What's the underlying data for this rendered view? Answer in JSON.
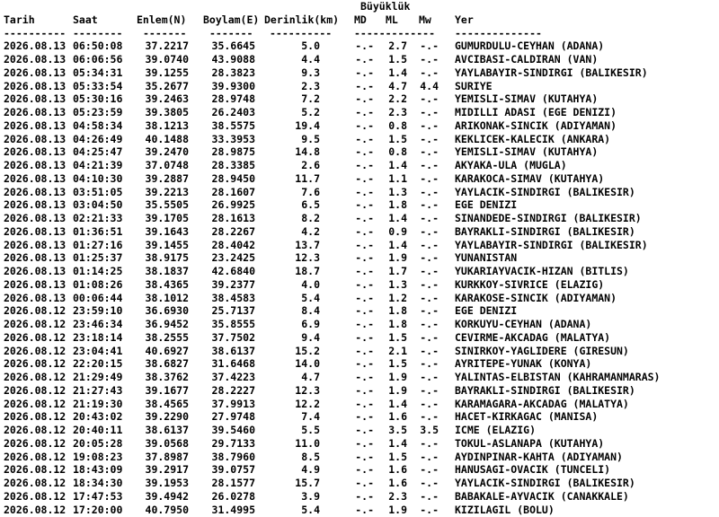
{
  "header": {
    "group_title": "Büyüklük",
    "columns": {
      "date": "Tarih",
      "time": "Saat",
      "lat": "Enlem(N)",
      "lon": "Boylam(E)",
      "depth": "Derinlik(km)",
      "md": "MD",
      "ml": "ML",
      "mw": "Mw",
      "place": "Yer"
    },
    "rule": {
      "date": "----------",
      "time": "--------",
      "lat": "-------",
      "lon": "-------",
      "depth": "----------",
      "mag": "-------------",
      "place": "--------------"
    }
  },
  "rows": [
    {
      "date": "2026.08.13",
      "time": "06:50:08",
      "lat": "37.2217",
      "lon": "35.6645",
      "depth": "5.0",
      "md": "-.-",
      "ml": "2.7",
      "mw": "-.-",
      "place": "GUMURDULU-CEYHAN (ADANA)"
    },
    {
      "date": "2026.08.13",
      "time": "06:06:56",
      "lat": "39.0740",
      "lon": "43.9088",
      "depth": "4.4",
      "md": "-.-",
      "ml": "1.5",
      "mw": "-.-",
      "place": "AVCIBASI-CALDIRAN (VAN)"
    },
    {
      "date": "2026.08.13",
      "time": "05:34:31",
      "lat": "39.1255",
      "lon": "28.3823",
      "depth": "9.3",
      "md": "-.-",
      "ml": "1.4",
      "mw": "-.-",
      "place": "YAYLABAYIR-SINDIRGI (BALIKESIR)"
    },
    {
      "date": "2026.08.13",
      "time": "05:33:54",
      "lat": "35.2677",
      "lon": "39.9300",
      "depth": "2.3",
      "md": "-.-",
      "ml": "4.7",
      "mw": "4.4",
      "place": "SURIYE"
    },
    {
      "date": "2026.08.13",
      "time": "05:30:16",
      "lat": "39.2463",
      "lon": "28.9748",
      "depth": "7.2",
      "md": "-.-",
      "ml": "2.2",
      "mw": "-.-",
      "place": "YEMISLI-SIMAV (KUTAHYA)"
    },
    {
      "date": "2026.08.13",
      "time": "05:23:59",
      "lat": "39.3805",
      "lon": "26.2403",
      "depth": "5.2",
      "md": "-.-",
      "ml": "2.3",
      "mw": "-.-",
      "place": "MIDILLI ADASI (EGE DENIZI)"
    },
    {
      "date": "2026.08.13",
      "time": "04:58:34",
      "lat": "38.1213",
      "lon": "38.5575",
      "depth": "19.4",
      "md": "-.-",
      "ml": "0.8",
      "mw": "-.-",
      "place": "ARIKONAK-SINCIK (ADIYAMAN)"
    },
    {
      "date": "2026.08.13",
      "time": "04:26:49",
      "lat": "40.1488",
      "lon": "33.3953",
      "depth": "9.5",
      "md": "-.-",
      "ml": "1.5",
      "mw": "-.-",
      "place": "KEKLICEK-KALECIK (ANKARA)"
    },
    {
      "date": "2026.08.13",
      "time": "04:25:47",
      "lat": "39.2470",
      "lon": "28.9875",
      "depth": "14.8",
      "md": "-.-",
      "ml": "0.8",
      "mw": "-.-",
      "place": "YEMISLI-SIMAV (KUTAHYA)"
    },
    {
      "date": "2026.08.13",
      "time": "04:21:39",
      "lat": "37.0748",
      "lon": "28.3385",
      "depth": "2.6",
      "md": "-.-",
      "ml": "1.4",
      "mw": "-.-",
      "place": "AKYAKA-ULA (MUGLA)"
    },
    {
      "date": "2026.08.13",
      "time": "04:10:30",
      "lat": "39.2887",
      "lon": "28.9450",
      "depth": "11.7",
      "md": "-.-",
      "ml": "1.1",
      "mw": "-.-",
      "place": "KARAKOCA-SIMAV (KUTAHYA)"
    },
    {
      "date": "2026.08.13",
      "time": "03:51:05",
      "lat": "39.2213",
      "lon": "28.1607",
      "depth": "7.6",
      "md": "-.-",
      "ml": "1.3",
      "mw": "-.-",
      "place": "YAYLACIK-SINDIRGI (BALIKESIR)"
    },
    {
      "date": "2026.08.13",
      "time": "03:04:50",
      "lat": "35.5505",
      "lon": "26.9925",
      "depth": "6.5",
      "md": "-.-",
      "ml": "1.8",
      "mw": "-.-",
      "place": "EGE DENIZI"
    },
    {
      "date": "2026.08.13",
      "time": "02:21:33",
      "lat": "39.1705",
      "lon": "28.1613",
      "depth": "8.2",
      "md": "-.-",
      "ml": "1.4",
      "mw": "-.-",
      "place": "SINANDEDE-SINDIRGI (BALIKESIR)"
    },
    {
      "date": "2026.08.13",
      "time": "01:36:51",
      "lat": "39.1643",
      "lon": "28.2267",
      "depth": "4.2",
      "md": "-.-",
      "ml": "0.9",
      "mw": "-.-",
      "place": "BAYRAKLI-SINDIRGI (BALIKESIR)"
    },
    {
      "date": "2026.08.13",
      "time": "01:27:16",
      "lat": "39.1455",
      "lon": "28.4042",
      "depth": "13.7",
      "md": "-.-",
      "ml": "1.4",
      "mw": "-.-",
      "place": "YAYLABAYIR-SINDIRGI (BALIKESIR)"
    },
    {
      "date": "2026.08.13",
      "time": "01:25:37",
      "lat": "38.9175",
      "lon": "23.2425",
      "depth": "12.3",
      "md": "-.-",
      "ml": "1.9",
      "mw": "-.-",
      "place": "YUNANISTAN"
    },
    {
      "date": "2026.08.13",
      "time": "01:14:25",
      "lat": "38.1837",
      "lon": "42.6840",
      "depth": "18.7",
      "md": "-.-",
      "ml": "1.7",
      "mw": "-.-",
      "place": "YUKARIAYVACIK-HIZAN (BITLIS)"
    },
    {
      "date": "2026.08.13",
      "time": "01:08:26",
      "lat": "38.4365",
      "lon": "39.2377",
      "depth": "4.0",
      "md": "-.-",
      "ml": "1.3",
      "mw": "-.-",
      "place": "KURKKOY-SIVRICE (ELAZIG)"
    },
    {
      "date": "2026.08.13",
      "time": "00:06:44",
      "lat": "38.1012",
      "lon": "38.4583",
      "depth": "5.4",
      "md": "-.-",
      "ml": "1.2",
      "mw": "-.-",
      "place": "KARAKOSE-SINCIK (ADIYAMAN)"
    },
    {
      "date": "2026.08.12",
      "time": "23:59:10",
      "lat": "36.6930",
      "lon": "25.7137",
      "depth": "8.4",
      "md": "-.-",
      "ml": "1.8",
      "mw": "-.-",
      "place": "EGE DENIZI"
    },
    {
      "date": "2026.08.12",
      "time": "23:46:34",
      "lat": "36.9452",
      "lon": "35.8555",
      "depth": "6.9",
      "md": "-.-",
      "ml": "1.8",
      "mw": "-.-",
      "place": "KORKUYU-CEYHAN (ADANA)"
    },
    {
      "date": "2026.08.12",
      "time": "23:18:14",
      "lat": "38.2555",
      "lon": "37.7502",
      "depth": "9.4",
      "md": "-.-",
      "ml": "1.5",
      "mw": "-.-",
      "place": "CEVIRME-AKCADAG (MALATYA)"
    },
    {
      "date": "2026.08.12",
      "time": "23:04:41",
      "lat": "40.6927",
      "lon": "38.6137",
      "depth": "15.2",
      "md": "-.-",
      "ml": "2.1",
      "mw": "-.-",
      "place": "SINIRKOY-YAGLIDERE (GIRESUN)"
    },
    {
      "date": "2026.08.12",
      "time": "22:20:15",
      "lat": "38.6827",
      "lon": "31.6468",
      "depth": "14.0",
      "md": "-.-",
      "ml": "1.5",
      "mw": "-.-",
      "place": "AYRITEPE-YUNAK (KONYA)"
    },
    {
      "date": "2026.08.12",
      "time": "21:29:49",
      "lat": "38.3762",
      "lon": "37.4223",
      "depth": "4.7",
      "md": "-.-",
      "ml": "1.9",
      "mw": "-.-",
      "place": "YALINTAS-ELBISTAN (KAHRAMANMARAS)"
    },
    {
      "date": "2026.08.12",
      "time": "21:27:43",
      "lat": "39.1677",
      "lon": "28.2227",
      "depth": "12.3",
      "md": "-.-",
      "ml": "1.9",
      "mw": "-.-",
      "place": "BAYRAKLI-SINDIRGI (BALIKESIR)"
    },
    {
      "date": "2026.08.12",
      "time": "21:19:30",
      "lat": "38.4565",
      "lon": "37.9913",
      "depth": "12.2",
      "md": "-.-",
      "ml": "1.4",
      "mw": "-.-",
      "place": "KARAMAGARA-AKCADAG (MALATYA)"
    },
    {
      "date": "2026.08.12",
      "time": "20:43:02",
      "lat": "39.2290",
      "lon": "27.9748",
      "depth": "7.4",
      "md": "-.-",
      "ml": "1.6",
      "mw": "-.-",
      "place": "HACET-KIRKAGAC (MANISA)"
    },
    {
      "date": "2026.08.12",
      "time": "20:40:11",
      "lat": "38.6137",
      "lon": "39.5460",
      "depth": "5.5",
      "md": "-.-",
      "ml": "3.5",
      "mw": "3.5",
      "place": "ICME (ELAZIG)"
    },
    {
      "date": "2026.08.12",
      "time": "20:05:28",
      "lat": "39.0568",
      "lon": "29.7133",
      "depth": "11.0",
      "md": "-.-",
      "ml": "1.4",
      "mw": "-.-",
      "place": "TOKUL-ASLANAPA (KUTAHYA)"
    },
    {
      "date": "2026.08.12",
      "time": "19:08:23",
      "lat": "37.8987",
      "lon": "38.7960",
      "depth": "8.5",
      "md": "-.-",
      "ml": "1.5",
      "mw": "-.-",
      "place": "AYDINPINAR-KAHTA (ADIYAMAN)"
    },
    {
      "date": "2026.08.12",
      "time": "18:43:09",
      "lat": "39.2917",
      "lon": "39.0757",
      "depth": "4.9",
      "md": "-.-",
      "ml": "1.6",
      "mw": "-.-",
      "place": "HANUSAGI-OVACIK (TUNCELI)"
    },
    {
      "date": "2026.08.12",
      "time": "18:34:30",
      "lat": "39.1953",
      "lon": "28.1577",
      "depth": "15.7",
      "md": "-.-",
      "ml": "1.6",
      "mw": "-.-",
      "place": "YAYLACIK-SINDIRGI (BALIKESIR)"
    },
    {
      "date": "2026.08.12",
      "time": "17:47:53",
      "lat": "39.4942",
      "lon": "26.0278",
      "depth": "3.9",
      "md": "-.-",
      "ml": "2.3",
      "mw": "-.-",
      "place": "BABAKALE-AYVACIK (CANAKKALE)"
    },
    {
      "date": "2026.08.12",
      "time": "17:20:00",
      "lat": "40.7950",
      "lon": "31.4995",
      "depth": "5.4",
      "md": "-.-",
      "ml": "1.9",
      "mw": "-.-",
      "place": "KIZILAGIL (BOLU)"
    }
  ]
}
